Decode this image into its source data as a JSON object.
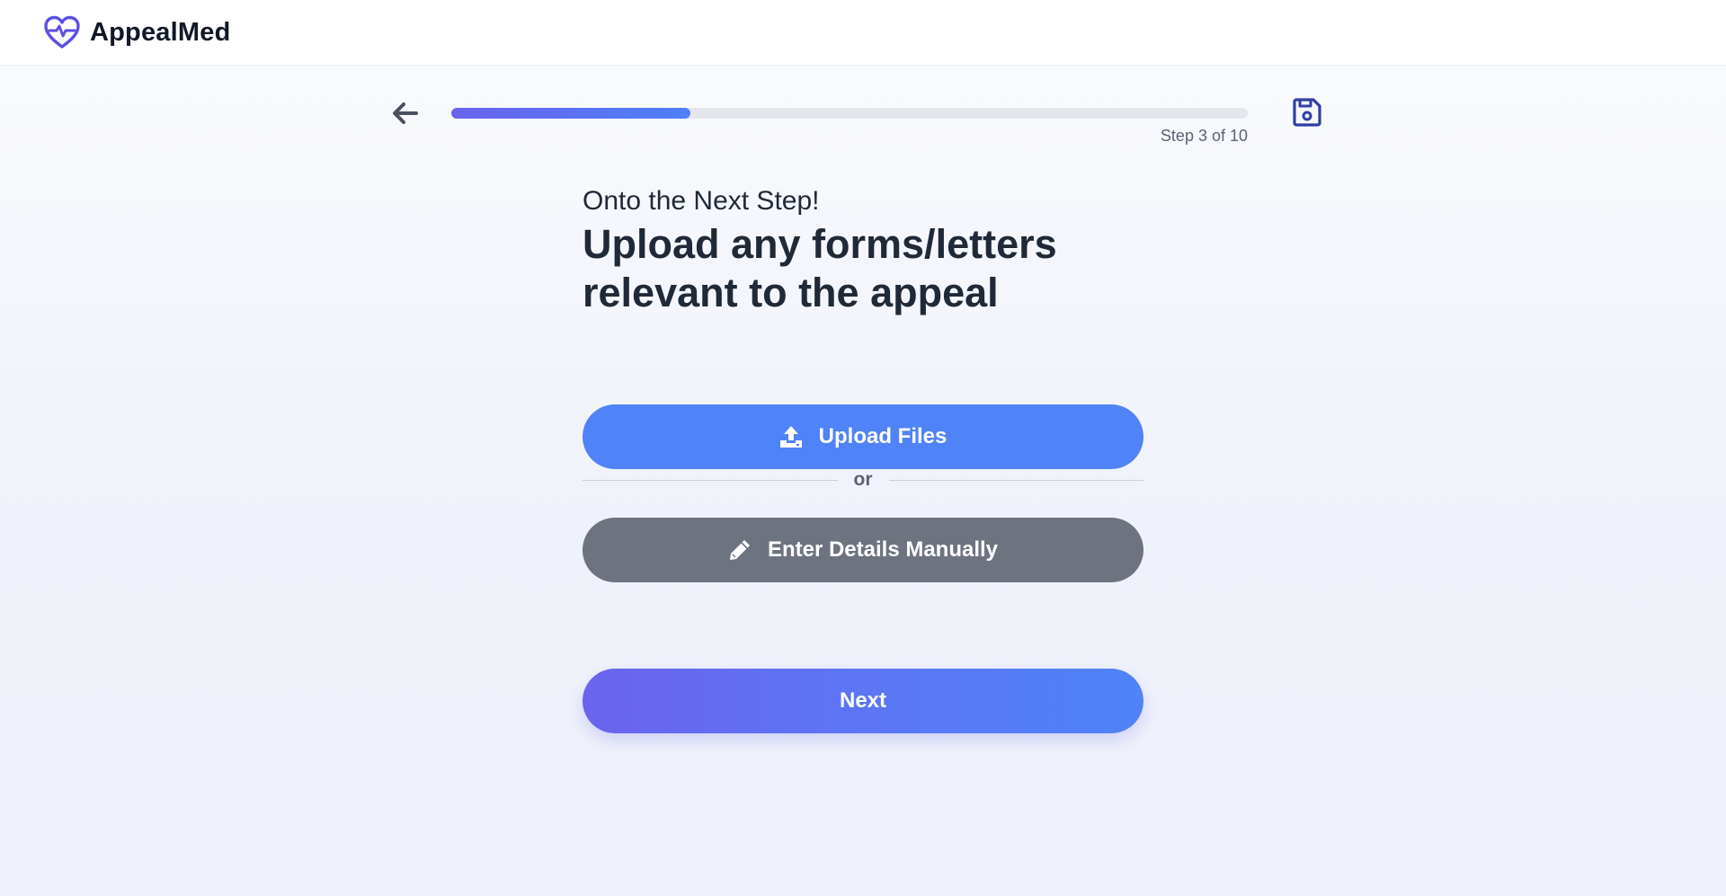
{
  "header": {
    "logo_text": "AppealMed",
    "logo_icon": "heart-pulse-icon",
    "brand_color": "#5b4fe6"
  },
  "progress": {
    "back_icon": "arrow-left-icon",
    "current_step": 3,
    "total_steps": 10,
    "fraction": 0.3,
    "step_label": "Step 3 of 10",
    "save_icon": "floppy-disk-icon",
    "save_color": "#2f3fa3"
  },
  "content": {
    "subtitle": "Onto the Next Step!",
    "title": "Upload any forms/letters relevant to the appeal"
  },
  "actions": {
    "upload_label": "Upload Files",
    "upload_icon": "upload-icon",
    "divider_text": "or",
    "manual_label": "Enter Details Manually",
    "manual_icon": "pencil-icon",
    "next_label": "Next"
  },
  "colors": {
    "primary": "#4f83f7",
    "secondary": "#6e7380",
    "gradient_start": "#6a63ee",
    "text_dark": "#1f2937"
  }
}
